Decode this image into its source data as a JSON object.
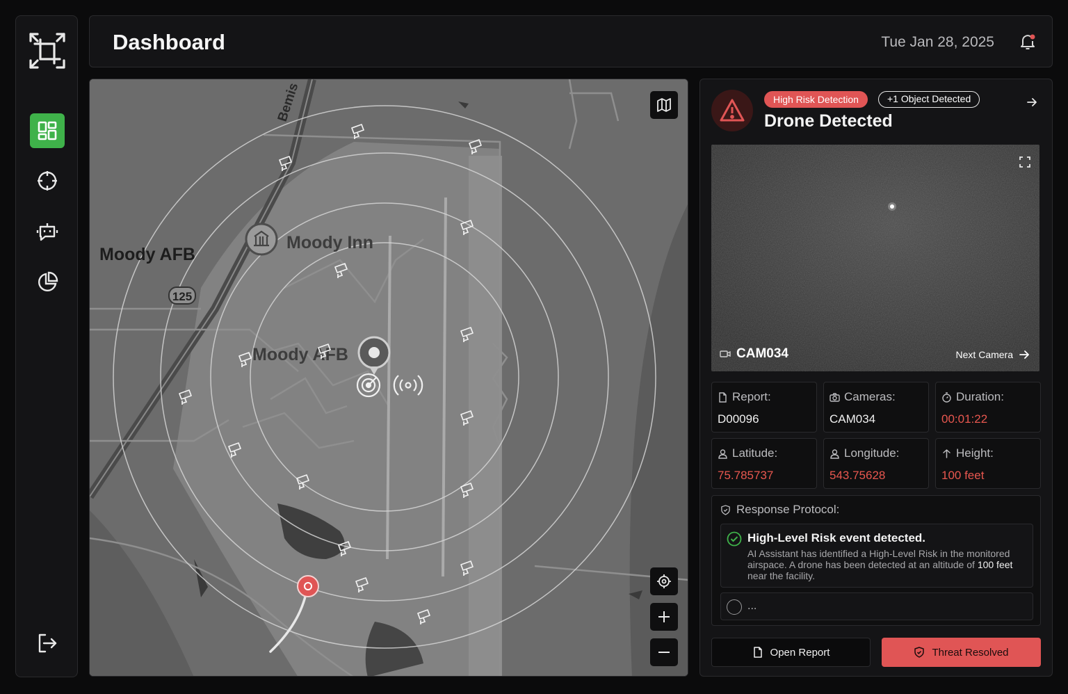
{
  "header": {
    "title": "Dashboard",
    "date": "Tue Jan 28, 2025"
  },
  "sidebar": {
    "items": [
      {
        "icon": "dashboard-grid-icon",
        "active": true
      },
      {
        "icon": "crosshair-icon",
        "active": false
      },
      {
        "icon": "bot-icon",
        "active": false
      },
      {
        "icon": "pie-chart-icon",
        "active": false
      }
    ],
    "logout_icon": "logout-icon"
  },
  "map": {
    "labels": {
      "area_main": "Moody AFB",
      "place": "Moody Inn",
      "area_base": "Moody AFB",
      "road": "Bemis",
      "route": "125"
    }
  },
  "alert": {
    "badge_risk": "High Risk Detection",
    "badge_objects": "+1 Object Detected",
    "title": "Drone Detected",
    "camera_name": "CAM034",
    "next_camera": "Next Camera",
    "stats": {
      "report_label": "Report:",
      "report_value": "D00096",
      "cameras_label": "Cameras:",
      "cameras_value": "CAM034",
      "duration_label": "Duration:",
      "duration_value": "00:01:22",
      "latitude_label": "Latitude:",
      "latitude_value": "75.785737",
      "longitude_label": "Longitude:",
      "longitude_value": "543.75628",
      "height_label": "Height:",
      "height_value": "100 feet"
    },
    "protocol": {
      "title": "Response Protocol:",
      "step1_title": "High-Level Risk event detected.",
      "step1_text_a": "AI Assistant has identified a High-Level Risk in the monitored airspace. A drone has been detected at an altitude of ",
      "step1_text_b": "100 feet",
      "step1_text_c": " near the facility.",
      "step2_text": "..."
    },
    "buttons": {
      "open_report": "Open Report",
      "threat_resolved": "Threat Resolved"
    }
  },
  "colors": {
    "accent_green": "#3fb24a",
    "danger_red": "#e05555",
    "panel": "#141416"
  }
}
